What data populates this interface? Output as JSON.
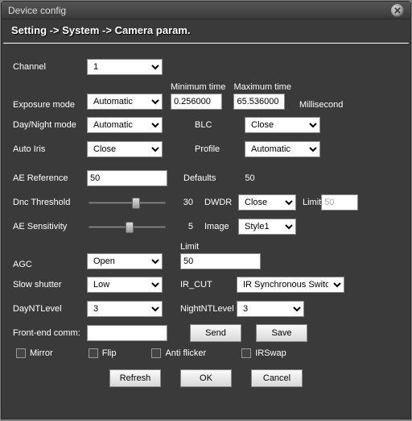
{
  "window": {
    "title": "Device config"
  },
  "breadcrumb": "Setting -> System -> Camera param.",
  "labels": {
    "channel": "Channel",
    "exposure": "Exposure mode",
    "min_time": "Minimum time",
    "max_time": "Maximum time",
    "ms": "Millisecond",
    "daynight": "Day/Night mode",
    "blc": "BLC",
    "autoiris": "Auto Iris",
    "profile": "Profile",
    "aeref": "AE Reference",
    "defaults": "Defaults",
    "dncthr": "Dnc Threshold",
    "dwdr": "DWDR",
    "limit": "Limit",
    "aesens": "AE Sensitivity",
    "image": "Image",
    "agc": "AGC",
    "slowshutter": "Slow shutter",
    "ircut": "IR_CUT",
    "dayntlevel": "DayNTLevel",
    "nightntlevel": "NightNTLevel",
    "frontend": "Front-end comm:"
  },
  "values": {
    "channel": "1",
    "exposure": "Automatic",
    "min_time": "0.256000",
    "max_time": "65.536000",
    "daynight": "Automatic",
    "blc": "Close",
    "autoiris": "Close",
    "profile": "Automatic",
    "aeref": "50",
    "defaults_val": "50",
    "dncthr": "30",
    "dwdr": "Close",
    "dwdr_limit": "50",
    "aesens": "5",
    "image": "Style1",
    "agc": "Open",
    "agc_limit": "50",
    "slowshutter": "Low",
    "ircut": "IR Synchronous Switch",
    "dayntlevel": "3",
    "nightntlevel": "3",
    "frontend": ""
  },
  "checkboxes": {
    "mirror": "Mirror",
    "flip": "Flip",
    "antiflicker": "Anti flicker",
    "irswap": "IRSwap"
  },
  "buttons": {
    "send": "Send",
    "save": "Save",
    "refresh": "Refresh",
    "ok": "OK",
    "cancel": "Cancel"
  }
}
